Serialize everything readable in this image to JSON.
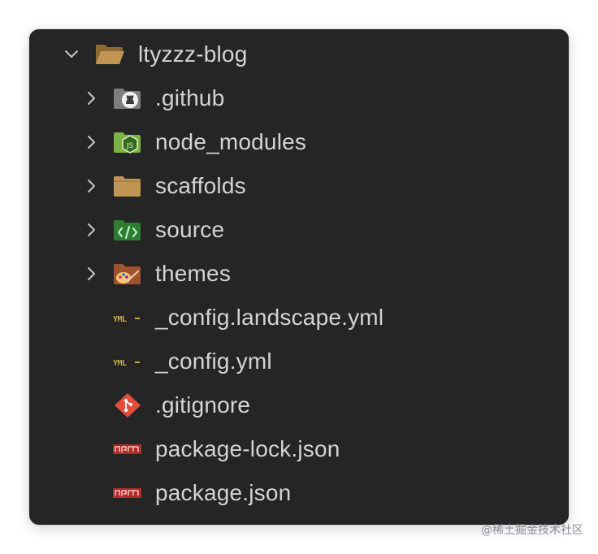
{
  "explorer": {
    "root": {
      "label": "ltyzzz-blog",
      "expanded": true,
      "icon": "folder-open-icon",
      "color": "#c09553"
    },
    "items": [
      {
        "label": ".github",
        "type": "folder",
        "icon": "github-folder-icon",
        "color": "#8a8a8a"
      },
      {
        "label": "node_modules",
        "type": "folder",
        "icon": "node-modules-folder-icon",
        "color": "#8bc34a"
      },
      {
        "label": "scaffolds",
        "type": "folder",
        "icon": "folder-icon",
        "color": "#c09553"
      },
      {
        "label": "source",
        "type": "folder",
        "icon": "source-folder-icon",
        "color": "#2e7d32"
      },
      {
        "label": "themes",
        "type": "folder",
        "icon": "themes-folder-icon",
        "color": "#a0522d"
      },
      {
        "label": "_config.landscape.yml",
        "type": "file",
        "icon": "yaml-file-icon",
        "color": "#c8a64a"
      },
      {
        "label": "_config.yml",
        "type": "file",
        "icon": "yaml-file-icon",
        "color": "#c8a64a"
      },
      {
        "label": ".gitignore",
        "type": "file",
        "icon": "git-file-icon",
        "color": "#e44c3a"
      },
      {
        "label": "package-lock.json",
        "type": "file",
        "icon": "npm-file-icon",
        "color": "#b22a2a"
      },
      {
        "label": "package.json",
        "type": "file",
        "icon": "npm-file-icon",
        "color": "#b22a2a"
      }
    ]
  },
  "watermark": {
    "text": "@稀土掘金技术社区"
  },
  "colors": {
    "panel_background": "#252526",
    "text": "#d4d4d4",
    "chevron": "#c5c5c5"
  }
}
